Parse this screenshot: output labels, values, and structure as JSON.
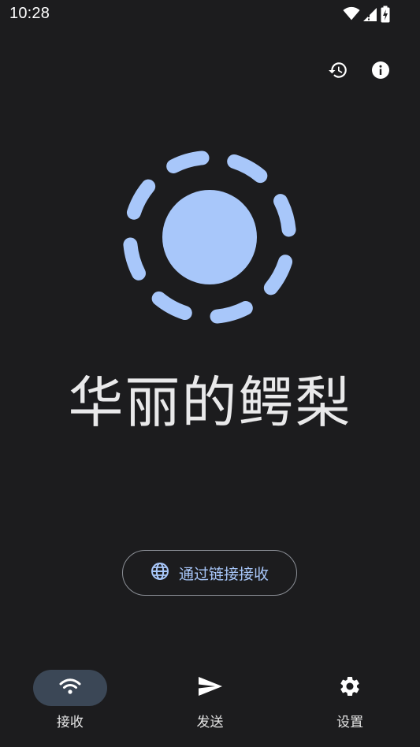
{
  "status_bar": {
    "time": "10:28",
    "icons": [
      "wifi-icon",
      "cellular-signal-icon",
      "battery-charging-icon"
    ]
  },
  "top_actions": {
    "icons": [
      "history-icon",
      "info-icon"
    ]
  },
  "main": {
    "device_name": "华丽的鳄梨",
    "receive_by_link_label": "通过链接接收",
    "receive_by_link_icon": "globe-icon",
    "beacon_icon": "radar-beacon-icon"
  },
  "bottom_nav": {
    "items": [
      {
        "label": "接收",
        "icon": "wifi-icon",
        "active": true
      },
      {
        "label": "发送",
        "icon": "send-icon",
        "active": false
      },
      {
        "label": "设置",
        "icon": "gear-icon",
        "active": false
      }
    ]
  },
  "colors": {
    "background": "#1c1c1e",
    "accent": "#a8c7fa",
    "nav_active_pill": "#3b4756",
    "text_primary": "#e9e9ea"
  }
}
